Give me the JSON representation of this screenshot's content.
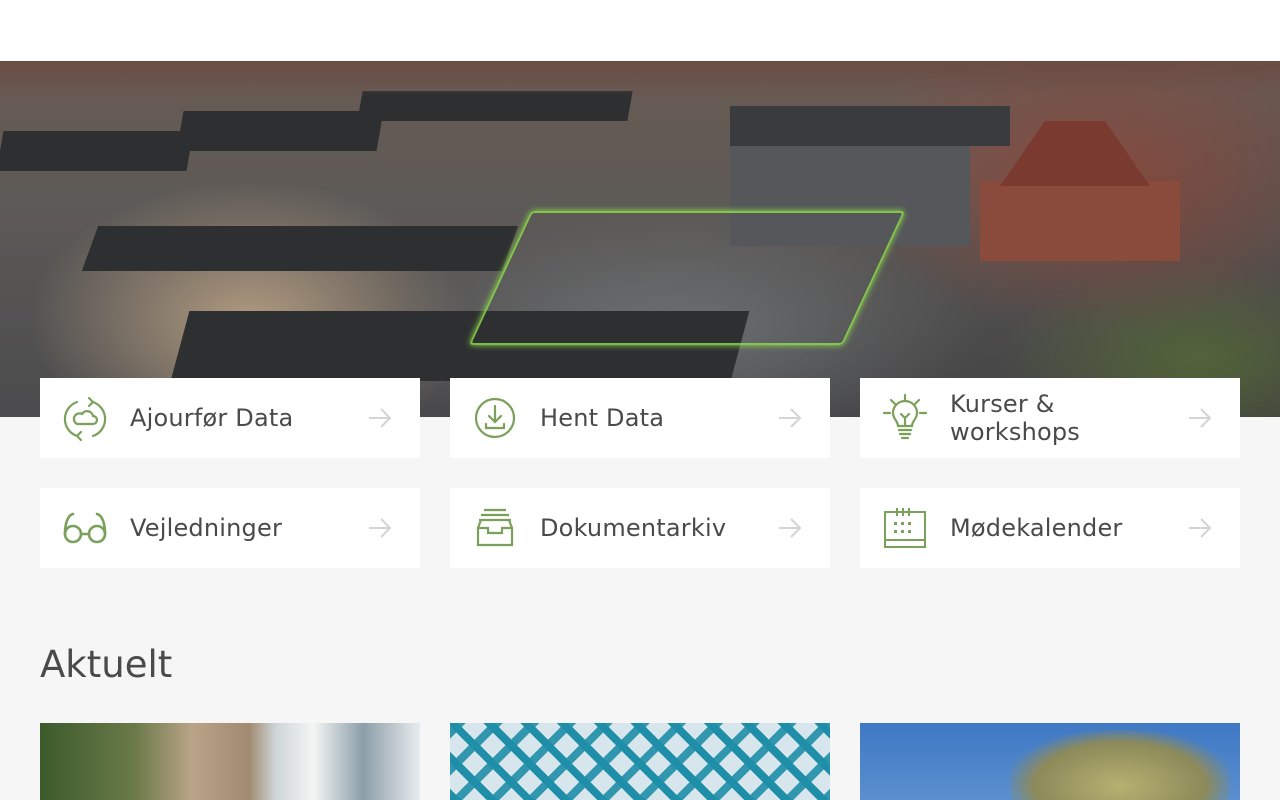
{
  "tiles": [
    {
      "label": "Ajourfør Data",
      "icon": "cloud-sync-icon"
    },
    {
      "label": "Hent Data",
      "icon": "download-icon"
    },
    {
      "label": "Kurser & workshops",
      "icon": "lightbulb-icon"
    },
    {
      "label": "Vejledninger",
      "icon": "glasses-icon"
    },
    {
      "label": "Dokumentarkiv",
      "icon": "archive-tray-icon"
    },
    {
      "label": "Mødekalender",
      "icon": "calendar-icon"
    }
  ],
  "news": {
    "heading": "Aktuelt"
  },
  "colors": {
    "accent": "#7ba05b",
    "arrow": "#d4d4d4",
    "background": "#f6f6f6",
    "text": "#4a4a4a"
  }
}
